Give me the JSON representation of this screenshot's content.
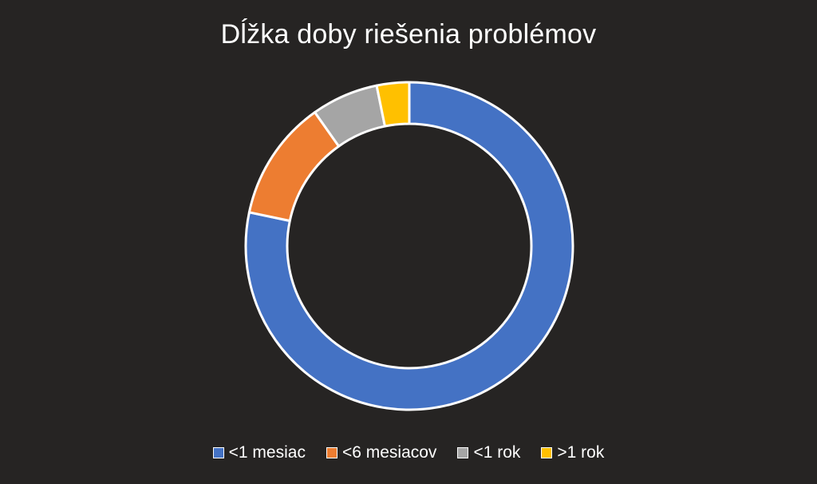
{
  "chart_data": {
    "type": "pie",
    "variant": "donut",
    "title": "Dĺžka doby riešenia problémov",
    "categories": [
      "<1 mesiac",
      "<6 mesiacov",
      "<1 rok",
      ">1 rok"
    ],
    "values": [
      78.3,
      11.9,
      6.6,
      3.2
    ],
    "colors": [
      "#4472C4",
      "#ED7D31",
      "#A5A5A5",
      "#FFC000"
    ],
    "legend_position": "bottom",
    "background": "#262423"
  }
}
